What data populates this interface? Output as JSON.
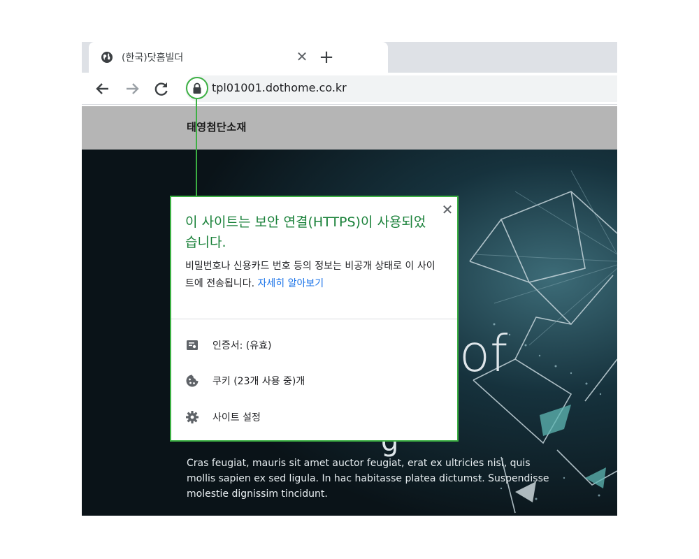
{
  "tab": {
    "title": "(한국)닷홈빌더"
  },
  "toolbar": {
    "url": "tpl01001.dothome.co.kr"
  },
  "site": {
    "logo": "태영첨단소재"
  },
  "hero": {
    "heading_fragment": "of",
    "tail_fragment": "g",
    "body": "Cras feugiat, mauris sit amet auctor feugiat, erat ex ultricies nisi, quis mollis sapien ex sed ligula. In hac habitasse platea dictumst. Suspendisse molestie dignissim tincidunt."
  },
  "popup": {
    "title": "이 사이트는 보안 연결(HTTPS)이 사용되었습니다.",
    "description": "비밀번호나 신용카드 번호 등의 정보는 비공개 상태로 이 사이트에 전송됩니다.",
    "learn_more": "자세히 알아보기",
    "items": [
      {
        "label": "인증서: (유효)",
        "icon": "certificate-icon"
      },
      {
        "label": "쿠키 (23개 사용 중)개",
        "icon": "cookie-icon"
      },
      {
        "label": "사이트 설정",
        "icon": "gear-icon"
      }
    ]
  },
  "colors": {
    "highlight": "#3cb043",
    "popup_title": "#188038",
    "link": "#1a73e8",
    "site_header": "#b5b5b5",
    "hero_bg": "#0b1a22"
  }
}
